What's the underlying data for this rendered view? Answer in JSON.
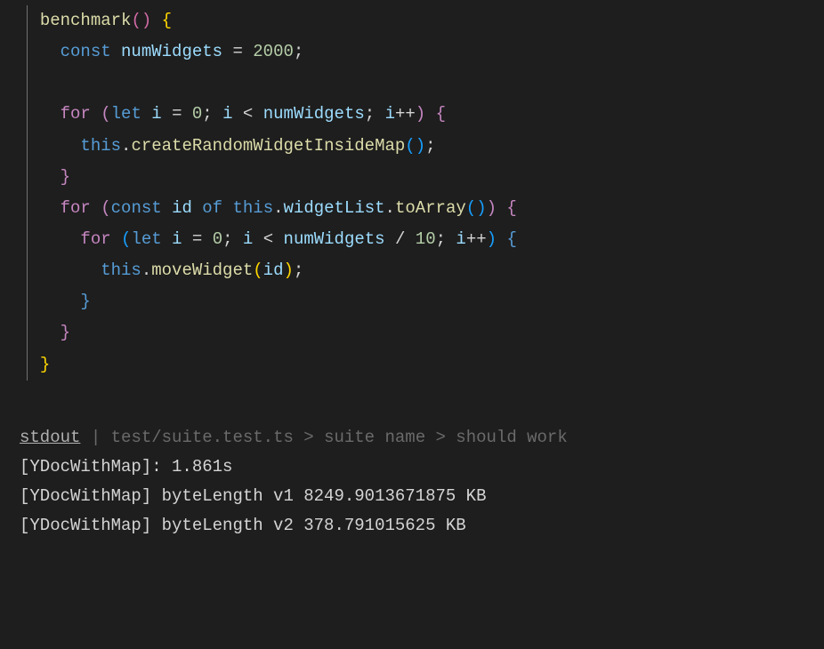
{
  "code": {
    "fn_name": "benchmark",
    "line2": {
      "kw_const": "const",
      "var_numWidgets": "numWidgets",
      "eq": "=",
      "num_2000": "2000",
      "semi": ";"
    },
    "for1": {
      "kw_for": "for",
      "kw_let": "let",
      "var_i": "i",
      "eq": "=",
      "num_0": "0",
      "lt": "<",
      "var_numWidgets": "numWidgets",
      "inc": "i++"
    },
    "call1": {
      "kw_this": "this",
      "method": "createRandomWidgetInsideMap"
    },
    "for2": {
      "kw_for": "for",
      "kw_const": "const",
      "var_id": "id",
      "kw_of": "of",
      "kw_this": "this",
      "prop_widgetList": "widgetList",
      "method_toArray": "toArray"
    },
    "for3": {
      "kw_for": "for",
      "kw_let": "let",
      "var_i": "i",
      "eq": "=",
      "num_0": "0",
      "lt": "<",
      "var_numWidgets": "numWidgets",
      "div": "/",
      "num_10": "10",
      "inc": "i++"
    },
    "call2": {
      "kw_this": "this",
      "method": "moveWidget",
      "arg": "id"
    }
  },
  "terminal": {
    "stdout_label": "stdout",
    "pipe": " | ",
    "test_path": "test/suite.test.ts > suite name > should work",
    "line1": "[YDocWithMap]: 1.861s",
    "line2": "[YDocWithMap] byteLength v1 8249.9013671875 KB",
    "line3": "[YDocWithMap] byteLength v2 378.791015625 KB"
  }
}
